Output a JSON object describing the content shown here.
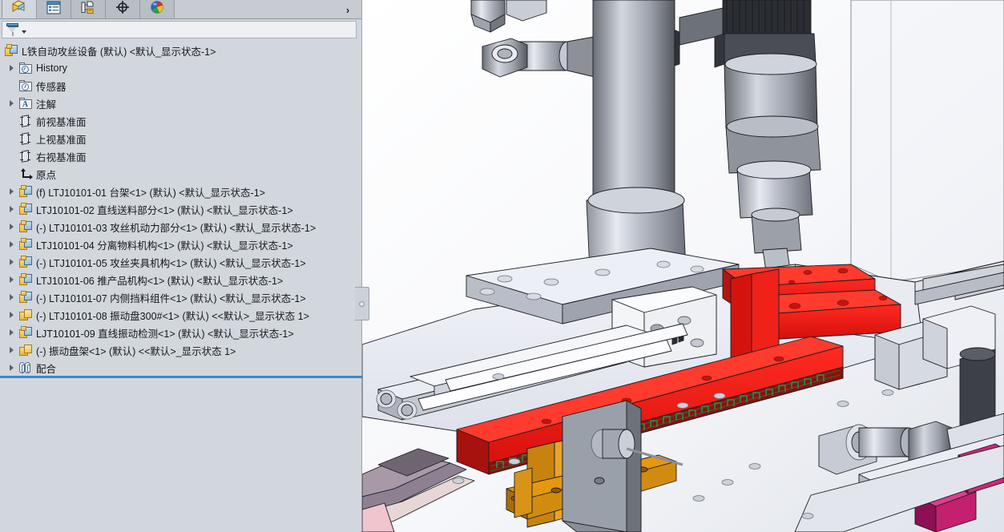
{
  "window": {
    "title": "SOLIDWORKS FeatureManager",
    "panel_title": "FeatureManager Design Tree"
  },
  "tabs": [
    {
      "name": "feature-manager-tab",
      "icon": "assembly-tree-icon",
      "label": "FeatureManager 设计树",
      "active": true
    },
    {
      "name": "property-manager-tab",
      "icon": "property-list-icon",
      "label": "PropertyManager",
      "active": false
    },
    {
      "name": "configuration-manager-tab",
      "icon": "configuration-icon",
      "label": "ConfigurationManager",
      "active": false
    },
    {
      "name": "dimxpert-manager-tab",
      "icon": "dimxpert-crosshair-icon",
      "label": "DimXpertManager",
      "active": false
    },
    {
      "name": "display-manager-tab",
      "icon": "display-color-ball-icon",
      "label": "DisplayManager",
      "active": false
    }
  ],
  "tab_expand": {
    "label": "›",
    "icon": "chevron-right-icon"
  },
  "filter": {
    "icon": "filter-funnel-icon",
    "dropdown_icon": "chevron-down-icon",
    "value": "",
    "placeholder": ""
  },
  "tree": {
    "root": {
      "label": "L铁自动攻丝设备 (默认) <默认_显示状态-1>",
      "icon": "assembly-icon",
      "has_twisty": false,
      "level": 0
    },
    "items": [
      {
        "label": "History",
        "icon": "history-folder-icon",
        "twisty": true,
        "level": 1,
        "indent": false
      },
      {
        "label": "传感器",
        "icon": "sensor-folder-icon",
        "twisty": false,
        "level": 1,
        "indent": true
      },
      {
        "label": "注解",
        "icon": "annotation-folder-icon",
        "twisty": true,
        "level": 1,
        "indent": false
      },
      {
        "label": "前视基准面",
        "icon": "plane-icon",
        "twisty": false,
        "level": 1,
        "indent": true
      },
      {
        "label": "上视基准面",
        "icon": "plane-icon",
        "twisty": false,
        "level": 1,
        "indent": true
      },
      {
        "label": "右视基准面",
        "icon": "plane-icon",
        "twisty": false,
        "level": 1,
        "indent": true
      },
      {
        "label": "原点",
        "icon": "origin-icon",
        "twisty": false,
        "level": 1,
        "indent": true
      },
      {
        "label": "(f) LTJ10101-01 台架<1>  (默认)  <默认_显示状态-1>",
        "icon": "assembly-icon",
        "twisty": true,
        "level": 1,
        "indent": false
      },
      {
        "label": "LTJ10101-02 直线送料部分<1>  (默认)  <默认_显示状态-1>",
        "icon": "assembly-icon",
        "twisty": true,
        "level": 1,
        "indent": false
      },
      {
        "label": "(-) LTJ10101-03 攻丝机动力部分<1>  (默认)  <默认_显示状态-1>",
        "icon": "assembly-icon",
        "twisty": true,
        "level": 1,
        "indent": false
      },
      {
        "label": "LTJ10101-04 分离物料机构<1>  (默认)  <默认_显示状态-1>",
        "icon": "assembly-icon",
        "twisty": true,
        "level": 1,
        "indent": false
      },
      {
        "label": "(-) LTJ10101-05 攻丝夹具机构<1>  (默认)  <默认_显示状态-1>",
        "icon": "assembly-icon",
        "twisty": true,
        "level": 1,
        "indent": false
      },
      {
        "label": "LTJ10101-06 推产品机构<1>  (默认)  <默认_显示状态-1>",
        "icon": "assembly-icon",
        "twisty": true,
        "level": 1,
        "indent": false
      },
      {
        "label": "(-) LTJ10101-07 内侧挡料组件<1>  (默认)  <默认_显示状态-1>",
        "icon": "assembly-icon",
        "twisty": true,
        "level": 1,
        "indent": false
      },
      {
        "label": "(-) LTJ10101-08 振动盘300#<1>  (默认)  <<默认>_显示状态 1>",
        "icon": "part-icon",
        "twisty": true,
        "level": 1,
        "indent": false
      },
      {
        "label": "LJT10101-09 直线振动检测<1>  (默认)  <默认_显示状态-1>",
        "icon": "assembly-icon",
        "twisty": true,
        "level": 1,
        "indent": false
      },
      {
        "label": "(-) 振动盘架<1>  (默认)  <<默认>_显示状态 1>",
        "icon": "part-icon",
        "twisty": true,
        "level": 1,
        "indent": false
      },
      {
        "label": "配合",
        "icon": "mates-icon",
        "twisty": true,
        "level": 1,
        "indent": false
      }
    ]
  },
  "splitter": {
    "icon": "panel-collapse-handle-icon",
    "label": ""
  },
  "viewport": {
    "name": "3d-graphics-area",
    "model": "L铁自动攻丝设备",
    "background": "#ffffff"
  },
  "colors": {
    "panel_bg": "#d2d7dd",
    "tab_bg": "#c8ccd2",
    "divider_blue": "#3c86c8",
    "text": "#14171a",
    "model_red": "#f01e1e",
    "model_orange": "#d98c18",
    "model_magenta": "#c42070",
    "model_grey": "#b8bcc6",
    "model_light": "#e3e6ef"
  }
}
